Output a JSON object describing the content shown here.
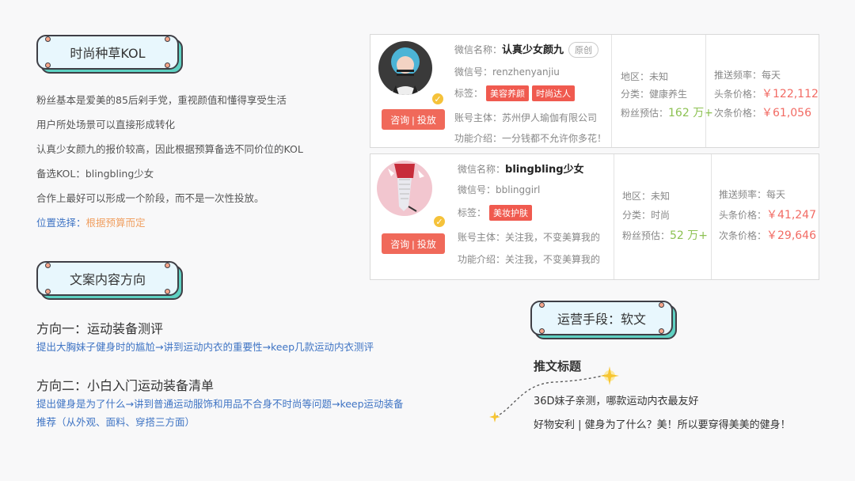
{
  "section1": {
    "badge": "时尚种草KOL",
    "lines": [
      "粉丝基本是爱美的85后剁手党，重视颜值和懂得享受生活",
      "用户所处场景可以直接形成转化",
      "认真少女颜九的报价较高，因此根据预算备选不同价位的KOL",
      "备选KOL：blingbling少女",
      "合作上最好可以形成一个阶段，而不是一次性投放。"
    ],
    "location_label": "位置选择：",
    "location_value": "根据预算而定"
  },
  "section2": {
    "badge": "文案内容方向",
    "dir1_title": "方向一：运动装备测评",
    "dir1_desc": "提出大胸妹子健身时的尴尬→讲到运动内衣的重要性→keep几款运动内衣测评",
    "dir2_title": "方向二：小白入门运动装备清单",
    "dir2_desc": "提出健身是为了什么→讲到普通运动服饰和用品不合身不时尚等问题→keep运动装备推荐（从外观、面料、穿搭三方面）"
  },
  "cards": [
    {
      "ask_label": "咨询 | 投放",
      "name_label": "微信名称：",
      "name": "认真少女颜九",
      "original": "原创",
      "wechat_label": "微信号：",
      "wechat": "renzhenyanjiu",
      "tags_label": "标签：",
      "tags": [
        "美容养颜",
        "时尚达人"
      ],
      "owner_label": "账号主体：",
      "owner": "苏州伊人瑜伽有限公司",
      "intro_label": "功能介绍：",
      "intro": "一分钱都不允许你多花！",
      "region": "地区：未知",
      "category": "分类：健康养生",
      "fans_label": "粉丝预估：",
      "fans": "162 万+",
      "freq": "推送频率：每天",
      "head_label": "头条价格：",
      "head_price": "￥122,112",
      "second_label": "次条价格：",
      "second_price": "￥61,056"
    },
    {
      "ask_label": "咨询 | 投放",
      "name_label": "微信名称：",
      "name": "blingbling少女",
      "wechat_label": "微信号：",
      "wechat": "bblinggirl",
      "tags_label": "标签：",
      "tags": [
        "美妆护肤"
      ],
      "owner_label": "账号主体：",
      "owner": "关注我，不变美算我的",
      "intro_label": "功能介绍：",
      "intro": "关注我，不变美算我的",
      "region": "地区：未知",
      "category": "分类：时尚",
      "fans_label": "粉丝预估：",
      "fans": "52 万+",
      "freq": "推送频率：每天",
      "head_label": "头条价格：",
      "head_price": "￥41,247",
      "second_label": "次条价格：",
      "second_price": "￥29,646"
    }
  ],
  "section3": {
    "badge": "运营手段：软文",
    "title": "推文标题",
    "line1": "36D妹子亲测，哪款运动内衣最友好",
    "line2": "好物安利 | 健身为了什么？美！所以要穿得美美的健身！"
  },
  "colors": {
    "accent_red": "#f05a4f",
    "badge_fill": "#e8f7fd",
    "badge_shadow": "#5ed1c2",
    "link_blue": "#3f74c4",
    "fans_green": "#8cc152",
    "price_red": "#f26b64"
  },
  "icons": [
    "verified-check-icon",
    "sparkle-star-icon",
    "dashed-curve-connector"
  ]
}
